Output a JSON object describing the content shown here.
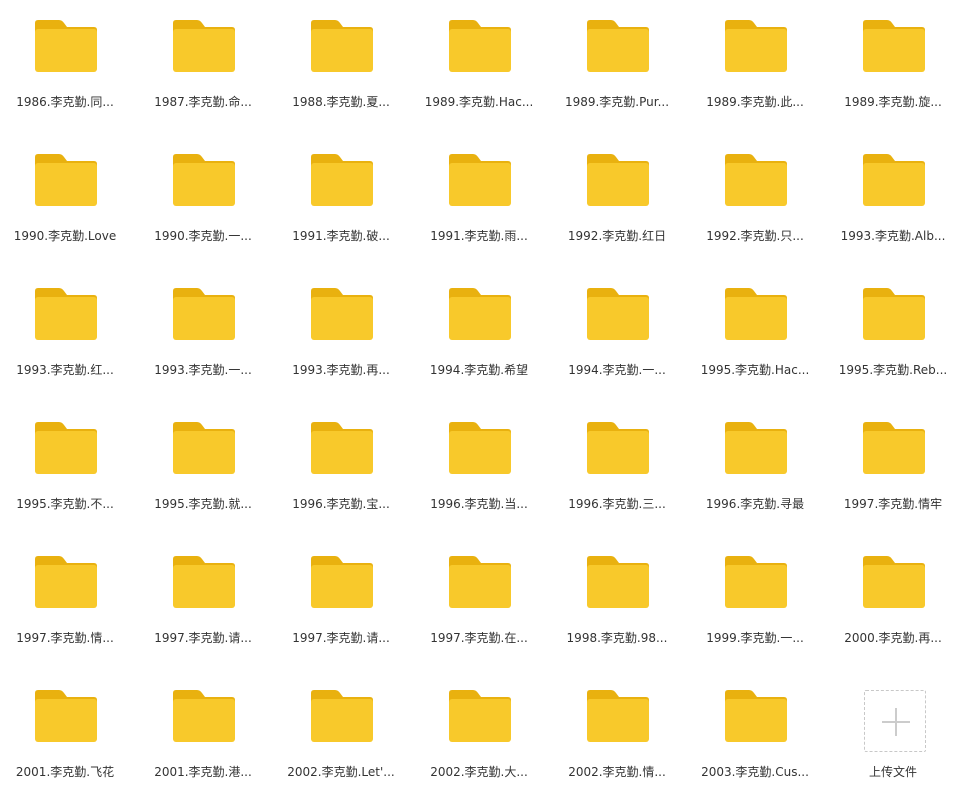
{
  "colors": {
    "folder_tab": "#E9B10F",
    "folder_body": "#F8C92B",
    "label_text": "#333333",
    "upload_border": "#C8C8C8",
    "upload_plus": "#CCCCCC"
  },
  "icons": {
    "folder": "folder-icon",
    "upload": "plus-icon"
  },
  "folders": [
    "1986.李克勤.同...",
    "1987.李克勤.命...",
    "1988.李克勤.夏...",
    "1989.李克勤.Hac...",
    "1989.李克勤.Pur...",
    "1989.李克勤.此...",
    "1989.李克勤.旋...",
    "1990.李克勤.Love",
    "1990.李克勤.一...",
    "1991.李克勤.破...",
    "1991.李克勤.雨...",
    "1992.李克勤.红日",
    "1992.李克勤.只...",
    "1993.李克勤.Alb...",
    "1993.李克勤.红...",
    "1993.李克勤.一...",
    "1993.李克勤.再...",
    "1994.李克勤.希望",
    "1994.李克勤.一...",
    "1995.李克勤.Hac...",
    "1995.李克勤.Reb...",
    "1995.李克勤.不...",
    "1995.李克勤.就...",
    "1996.李克勤.宝...",
    "1996.李克勤.当...",
    "1996.李克勤.三...",
    "1996.李克勤.寻最",
    "1997.李克勤.情牢",
    "1997.李克勤.情...",
    "1997.李克勤.请...",
    "1997.李克勤.请...",
    "1997.李克勤.在...",
    "1998.李克勤.98...",
    "1999.李克勤.一...",
    "2000.李克勤.再...",
    "2001.李克勤.飞花",
    "2001.李克勤.港...",
    "2002.李克勤.Let'...",
    "2002.李克勤.大...",
    "2002.李克勤.情...",
    "2003.李克勤.Cus..."
  ],
  "upload": {
    "label": "上传文件"
  }
}
